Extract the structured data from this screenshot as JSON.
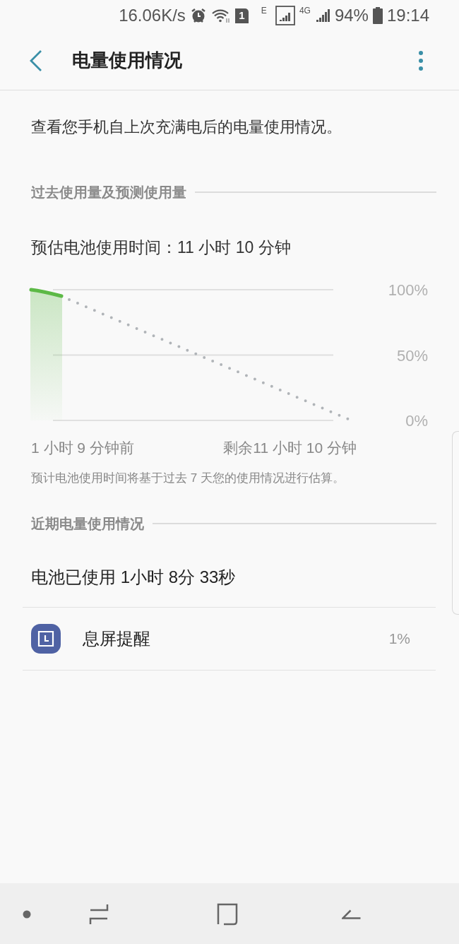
{
  "status_bar": {
    "speed": "16.06K/s",
    "sim": "1",
    "network_1": "E",
    "network_2": "4G",
    "battery": "94%",
    "time": "19:14"
  },
  "header": {
    "title": "电量使用情况"
  },
  "description": "查看您手机自上次充满电后的电量使用情况。",
  "history": {
    "heading": "过去使用量及预测使用量",
    "estimate": "预估电池使用时间：11 小时 10 分钟",
    "percent_labels": [
      "100%",
      "50%",
      "0%"
    ],
    "time_labels": [
      "1 小时 9 分钟前",
      "剩余11 小时 10 分钟"
    ],
    "note": "预计电池使用时间将基于过去 7 天您的使用情况进行估算。"
  },
  "recent": {
    "heading": "近期电量使用情况",
    "used": "电池已使用 1小时 8分 33秒",
    "apps": [
      {
        "name": "息屏提醒",
        "percent": "1%"
      }
    ]
  }
}
